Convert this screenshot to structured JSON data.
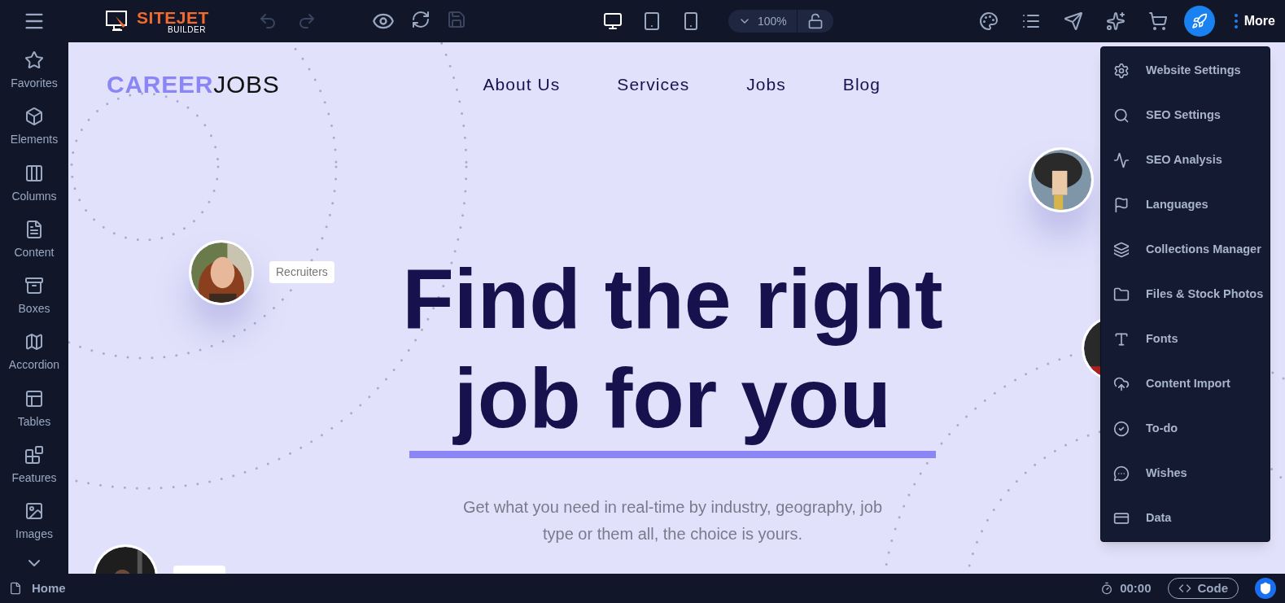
{
  "app_bar": {
    "logo": {
      "name": "SITEJET",
      "sub": "BUILDER"
    },
    "history": [
      {
        "disabled": true
      },
      {
        "disabled": true
      }
    ],
    "save": {
      "disabled": true
    },
    "devices": [
      {
        "selected": true
      },
      {
        "selected": false
      },
      {
        "selected": false
      }
    ],
    "zoom": "100%",
    "more": "More"
  },
  "sidebar": {
    "items": [
      {
        "label": "Favorites"
      },
      {
        "label": "Elements"
      },
      {
        "label": "Columns"
      },
      {
        "label": "Content"
      },
      {
        "label": "Boxes"
      },
      {
        "label": "Accordion"
      },
      {
        "label": "Tables"
      },
      {
        "label": "Features"
      },
      {
        "label": "Images"
      }
    ]
  },
  "page": {
    "logo": {
      "first": "CAREER",
      "second": "JOBS"
    },
    "nav": [
      "About Us",
      "Services",
      "Jobs",
      "Blog"
    ],
    "headline": [
      "Find the right",
      "job for you"
    ],
    "subtitle": "Get what you need in real-time by industry, geography, job type or them all, the choice is yours.",
    "tag": "Recruiters"
  },
  "more_menu": {
    "items": [
      {
        "label": "Website Settings"
      },
      {
        "label": "SEO Settings"
      },
      {
        "label": "SEO Analysis"
      },
      {
        "label": "Languages"
      },
      {
        "label": "Collections Manager"
      },
      {
        "label": "Files & Stock Photos"
      },
      {
        "label": "Fonts"
      },
      {
        "label": "Content Import"
      },
      {
        "label": "To-do"
      },
      {
        "label": "Wishes"
      },
      {
        "label": "Data"
      }
    ]
  },
  "status_bar": {
    "page": "Home",
    "timer": "00:00",
    "code": "Code"
  }
}
